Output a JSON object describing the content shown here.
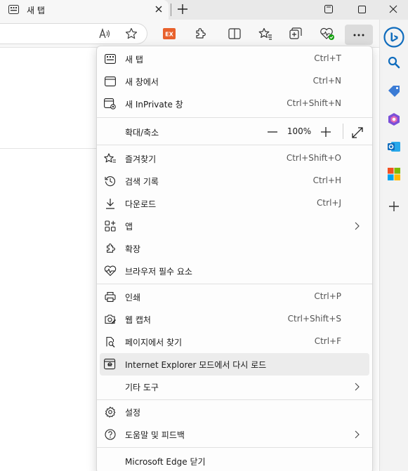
{
  "tab": {
    "title": "새 탭"
  },
  "address_bar": {
    "value": ""
  },
  "menu": {
    "items": [
      {
        "label": "새 탭",
        "shortcut": "Ctrl+T"
      },
      {
        "label": "새 창에서",
        "shortcut": "Ctrl+N"
      },
      {
        "label": "새 InPrivate 창",
        "shortcut": "Ctrl+Shift+N"
      },
      {
        "label": "확대/축소",
        "zoom": "100%"
      },
      {
        "label": "즐겨찾기",
        "shortcut": "Ctrl+Shift+O"
      },
      {
        "label": "검색 기록",
        "shortcut": "Ctrl+H"
      },
      {
        "label": "다운로드",
        "shortcut": "Ctrl+J"
      },
      {
        "label": "앱"
      },
      {
        "label": "확장"
      },
      {
        "label": "브라우저 필수 요소"
      },
      {
        "label": "인쇄",
        "shortcut": "Ctrl+P"
      },
      {
        "label": "웹 캡처",
        "shortcut": "Ctrl+Shift+S"
      },
      {
        "label": "페이지에서 찾기",
        "shortcut": "Ctrl+F"
      },
      {
        "label": "Internet Explorer 모드에서 다시 로드"
      },
      {
        "label": "기타 도구"
      },
      {
        "label": "설정"
      },
      {
        "label": "도움말 및 피드백"
      },
      {
        "label": "Microsoft Edge 닫기"
      }
    ]
  },
  "toolbar": {
    "ext_badge": "EX"
  },
  "colors": {
    "accent_blue": "#0f6cbd",
    "ext_orange": "#e8612c",
    "health_green": "#13a10e"
  }
}
